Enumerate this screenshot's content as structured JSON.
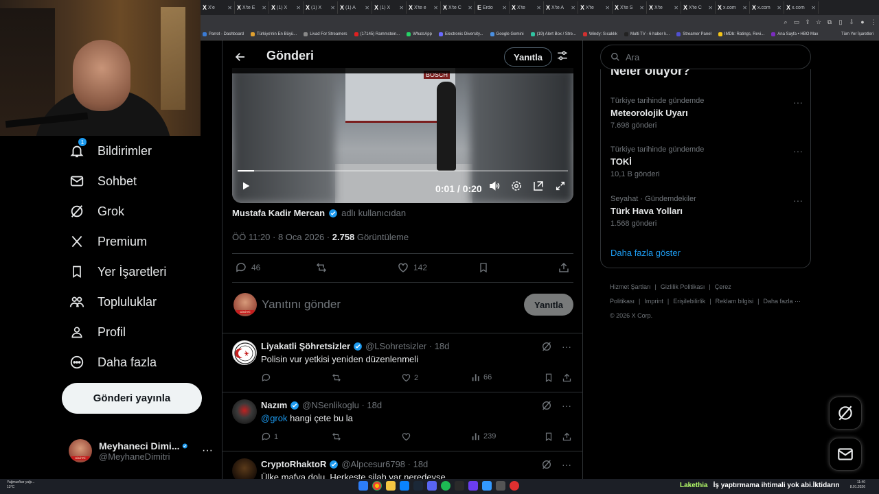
{
  "browser": {
    "tabs": [
      {
        "icon": "X",
        "label": "X'e"
      },
      {
        "icon": "X",
        "label": "X'te E"
      },
      {
        "icon": "X",
        "label": "(1) X"
      },
      {
        "icon": "X",
        "label": "(1) X"
      },
      {
        "icon": "X",
        "label": "(1) A"
      },
      {
        "icon": "X",
        "label": "(1) X"
      },
      {
        "icon": "X",
        "label": "X'te e"
      },
      {
        "icon": "X",
        "label": "X'te C"
      },
      {
        "icon": "E",
        "label": "Erdo"
      },
      {
        "icon": "X",
        "label": "X'te"
      },
      {
        "icon": "X",
        "label": "X'te A"
      },
      {
        "icon": "X",
        "label": "X'te"
      },
      {
        "icon": "X",
        "label": "X'te S"
      },
      {
        "icon": "X",
        "label": "X'te"
      },
      {
        "icon": "X",
        "label": "X'te C"
      },
      {
        "icon": "X",
        "label": "x.com"
      },
      {
        "icon": "X",
        "label": "x.com"
      },
      {
        "icon": "X",
        "label": "x.com"
      }
    ],
    "bookmarks": [
      {
        "label": "Parrot - Dashboard",
        "color": "#3a7bd5"
      },
      {
        "label": "Türkiye'nin En Büyü...",
        "color": "#e0a030"
      },
      {
        "label": "Livad For Streamers",
        "color": "#888888"
      },
      {
        "label": "(17145) Rammstein...",
        "color": "#e02020"
      },
      {
        "label": "WhatsApp",
        "color": "#25d366"
      },
      {
        "label": "Electronic Diversity...",
        "color": "#6a6aff"
      },
      {
        "label": "Google Gemini",
        "color": "#4a90e2"
      },
      {
        "label": "(19) Alert Box / Stre...",
        "color": "#31c3a2"
      },
      {
        "label": "Windy: Sıcaklık",
        "color": "#d03030"
      },
      {
        "label": "Multi TV - 6 haber k...",
        "color": "#222222"
      },
      {
        "label": "Streamer Panel",
        "color": "#5050d0"
      },
      {
        "label": "IMDb: Ratings, Revi...",
        "color": "#f5c518"
      },
      {
        "label": "Ana Sayfa • HBO Max",
        "color": "#7b2cbf"
      }
    ],
    "bookmarks_folder": "Tüm Yer İşaretleri"
  },
  "nav": {
    "notifications": {
      "label": "Bildirimler",
      "badge": "1"
    },
    "messages": {
      "label": "Sohbet"
    },
    "grok": {
      "label": "Grok"
    },
    "premium": {
      "label": "Premium"
    },
    "bookmarks": {
      "label": "Yer İşaretleri"
    },
    "communities": {
      "label": "Topluluklar"
    },
    "profile": {
      "label": "Profil"
    },
    "more": {
      "label": "Daha fazla"
    },
    "post_button": "Gönderi yayınla",
    "account": {
      "name": "Meyhaneci Dimi...",
      "handle": "@MeyhaneDimitri",
      "avatar_tag": "DİMİTRİ"
    }
  },
  "post": {
    "header_title": "Gönderi",
    "reply_toggle": "Yanıtla",
    "video": {
      "time": "0:01 / 0:20",
      "progress": 0.05,
      "shop_sign": "BOSCH"
    },
    "attribution_name": "Mustafa Kadir Mercan",
    "attribution_suffix": "adlı kullanıcıdan",
    "timestamp": "ÖÖ 11:20 · 8 Oca 2026 · ",
    "views": "2.758",
    "views_label": "Görüntüleme",
    "replies": "46",
    "likes": "142",
    "reply_placeholder": "Yanıtını gönder",
    "reply_button": "Yanıtla"
  },
  "replies": [
    {
      "name": "Liyakatli Şöhretsizler",
      "handle": "@LSohretsizler · 18d",
      "text": "Polisin vur yetkisi yeniden düzenlenmeli",
      "mention": "",
      "comments": "",
      "retweets": "",
      "likes": "2",
      "views": "66"
    },
    {
      "name": "Nazım",
      "handle": "@NSenlikoglu · 18d",
      "text": " hangi çete bu la",
      "mention": "@grok",
      "comments": "1",
      "retweets": "",
      "likes": "",
      "views": "239"
    },
    {
      "name": "CryptoRhaktoR",
      "handle": "@Alpcesur6798 · 18d",
      "text": "Ülke mafya dolu. Herkeste silah var neredeyse",
      "mention": "",
      "comments": "",
      "retweets": "",
      "likes": "",
      "views": ""
    }
  ],
  "sidebar": {
    "search_placeholder": "Ara",
    "trends_title": "Neler oluyor?",
    "trends": [
      {
        "context": "Türkiye tarihinde gündemde",
        "name": "Meteorolojik Uyarı",
        "count": "7.698 gönderi"
      },
      {
        "context": "Türkiye tarihinde gündemde",
        "name": "TOKİ",
        "count": "10,1 B gönderi"
      },
      {
        "context": "Seyahat · Gündemdekiler",
        "name": "Türk Hava Yolları",
        "count": "1.568 gönderi"
      }
    ],
    "show_more": "Daha fazla göster",
    "footer_links": [
      "Hizmet Şartları",
      "|",
      "Gizlilik Politikası",
      "|",
      "Çerez Politikası",
      "|",
      "Imprint",
      "|",
      "Erişilebilirlik",
      "|",
      "Reklam bilgisi",
      "|",
      "Daha fazla ···"
    ],
    "copyright": "© 2026 X Corp."
  },
  "taskbar": {
    "weather_line1": "Yağmur/kar yağı...",
    "weather_line2": "13°C",
    "ticker_name": "Lakethia",
    "ticker_text": "İş yaptırmama ihtimali yok abi.İktidarın",
    "time": "11:40",
    "date": "8.01.2026"
  },
  "colors": {
    "accent": "#1d9bf0",
    "muted": "#71767b",
    "text": "#e7e9ea",
    "border": "#2f3336"
  }
}
